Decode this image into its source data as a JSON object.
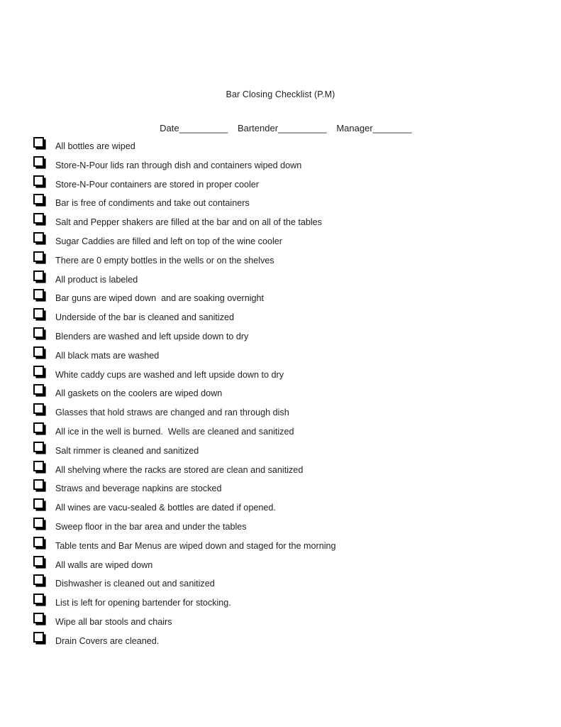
{
  "document": {
    "title": "Bar Closing Checklist (P.M)",
    "header": {
      "date_label": "Date",
      "date_rule": "__________",
      "bartender_label": "Bartender",
      "bartender_rule": "__________",
      "manager_label": "Manager",
      "manager_rule": "________"
    },
    "checkbox_icon": "empty-checkbox",
    "items": [
      {
        "label": "All bottles are wiped",
        "checked": false
      },
      {
        "label": "Store-N-Pour lids ran through dish and containers wiped down",
        "checked": false
      },
      {
        "label": "Store-N-Pour containers are stored in proper cooler",
        "checked": false
      },
      {
        "label": "Bar is free of condiments and take out containers",
        "checked": false
      },
      {
        "label": "Salt and Pepper shakers are filled at the bar and on all of the tables",
        "checked": false
      },
      {
        "label": "Sugar Caddies are filled and left on top of the wine cooler",
        "checked": false
      },
      {
        "label": "There are 0 empty bottles in the wells or on the shelves",
        "checked": false
      },
      {
        "label": "All product is labeled",
        "checked": false
      },
      {
        "label": "Bar guns are wiped down  and are soaking overnight",
        "checked": false
      },
      {
        "label": "Underside of the bar is cleaned and sanitized",
        "checked": false
      },
      {
        "label": "Blenders are washed and left upside down to dry",
        "checked": false
      },
      {
        "label": "All black mats are washed",
        "checked": false
      },
      {
        "label": "White caddy cups are washed and left upside down to dry",
        "checked": false
      },
      {
        "label": "All gaskets on the coolers are wiped down",
        "checked": false
      },
      {
        "label": "Glasses that hold straws are changed and ran through dish",
        "checked": false
      },
      {
        "label": "All ice in the well is burned.  Wells are cleaned and sanitized",
        "checked": false
      },
      {
        "label": "Salt rimmer is cleaned and sanitized",
        "checked": false
      },
      {
        "label": "All shelving where the racks are stored are clean and sanitized",
        "checked": false
      },
      {
        "label": "Straws and beverage napkins are stocked",
        "checked": false
      },
      {
        "label": "All wines are vacu-sealed & bottles are dated if opened.",
        "checked": false
      },
      {
        "label": "Sweep floor in the bar area and under the tables",
        "checked": false
      },
      {
        "label": "Table tents and Bar Menus are wiped down and staged for the morning",
        "checked": false
      },
      {
        "label": "All walls are wiped down",
        "checked": false
      },
      {
        "label": "Dishwasher is cleaned out and sanitized",
        "checked": false
      },
      {
        "label": "List is left for opening bartender for stocking.",
        "checked": false
      },
      {
        "label": "Wipe all bar stools and chairs",
        "checked": false
      },
      {
        "label": "Drain Covers are cleaned.",
        "checked": false
      }
    ]
  }
}
